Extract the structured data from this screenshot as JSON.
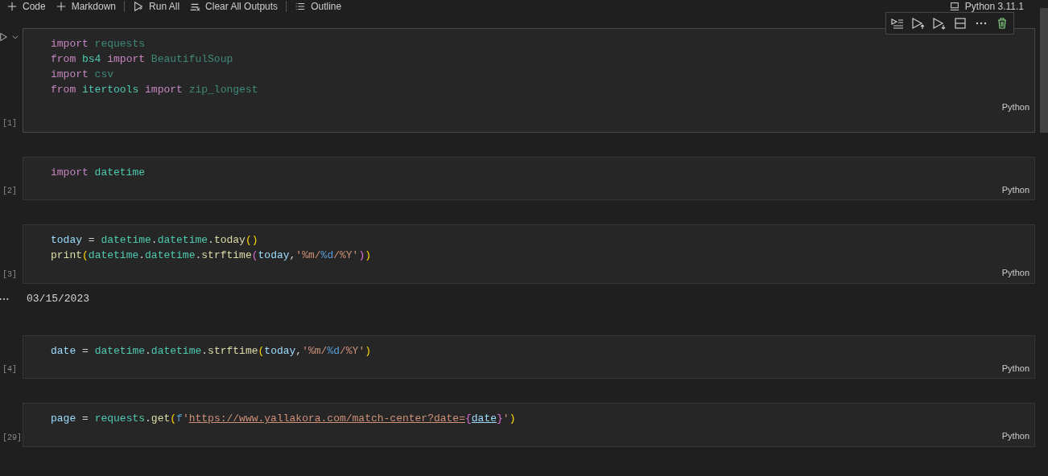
{
  "toolbar": {
    "items": [
      {
        "label": "Code",
        "kind": "add"
      },
      {
        "label": "Markdown",
        "kind": "add"
      },
      {
        "label": "Run All",
        "kind": "run"
      },
      {
        "label": "Clear All Outputs",
        "kind": "clear"
      },
      {
        "label": "Outline",
        "kind": "outline"
      }
    ],
    "kernel": "Python 3.11.1"
  },
  "cells": [
    {
      "execution_count": "[1]",
      "language": "Python",
      "focused": true,
      "lines": [
        [
          {
            "text": "import ",
            "kind": "keyword"
          },
          {
            "text": "requests",
            "kind": "unused"
          }
        ],
        [
          {
            "text": "from ",
            "kind": "keyword"
          },
          {
            "text": "bs4 ",
            "kind": "module"
          },
          {
            "text": "import ",
            "kind": "keyword"
          },
          {
            "text": "BeautifulSoup",
            "kind": "unused"
          }
        ],
        [
          {
            "text": "import ",
            "kind": "keyword"
          },
          {
            "text": "csv",
            "kind": "unused"
          }
        ],
        [
          {
            "text": "from ",
            "kind": "keyword"
          },
          {
            "text": "itertools ",
            "kind": "module"
          },
          {
            "text": "import ",
            "kind": "keyword"
          },
          {
            "text": "zip_longest",
            "kind": "unused"
          }
        ]
      ]
    },
    {
      "execution_count": "[2]",
      "language": "Python",
      "focused": false,
      "lines": [
        [
          {
            "text": "import ",
            "kind": "keyword"
          },
          {
            "text": "datetime",
            "kind": "module"
          }
        ]
      ]
    },
    {
      "execution_count": "[3]",
      "language": "Python",
      "focused": false,
      "lines": [
        [
          {
            "text": "today",
            "kind": "variable"
          },
          {
            "text": " = ",
            "kind": "plain"
          },
          {
            "text": "datetime",
            "kind": "module"
          },
          {
            "text": ".",
            "kind": "plain"
          },
          {
            "text": "datetime",
            "kind": "module"
          },
          {
            "text": ".",
            "kind": "plain"
          },
          {
            "text": "today",
            "kind": "function"
          },
          {
            "text": "()",
            "kind": "bracket1"
          }
        ],
        [
          {
            "text": "print",
            "kind": "function"
          },
          {
            "text": "(",
            "kind": "bracket1"
          },
          {
            "text": "datetime",
            "kind": "module"
          },
          {
            "text": ".",
            "kind": "plain"
          },
          {
            "text": "datetime",
            "kind": "module"
          },
          {
            "text": ".",
            "kind": "plain"
          },
          {
            "text": "strftime",
            "kind": "function"
          },
          {
            "text": "(",
            "kind": "bracket2"
          },
          {
            "text": "today",
            "kind": "variable"
          },
          {
            "text": ",",
            "kind": "plain"
          },
          {
            "text": "'%m/",
            "kind": "string"
          },
          {
            "text": "%d",
            "kind": "escape"
          },
          {
            "text": "/%Y'",
            "kind": "string"
          },
          {
            "text": ")",
            "kind": "bracket2"
          },
          {
            "text": ")",
            "kind": "bracket1"
          }
        ]
      ],
      "output": "03/15/2023"
    },
    {
      "execution_count": "[4]",
      "language": "Python",
      "focused": false,
      "lines": [
        [
          {
            "text": "date",
            "kind": "variable"
          },
          {
            "text": " = ",
            "kind": "plain"
          },
          {
            "text": "datetime",
            "kind": "module"
          },
          {
            "text": ".",
            "kind": "plain"
          },
          {
            "text": "datetime",
            "kind": "module"
          },
          {
            "text": ".",
            "kind": "plain"
          },
          {
            "text": "strftime",
            "kind": "function"
          },
          {
            "text": "(",
            "kind": "bracket1"
          },
          {
            "text": "today",
            "kind": "variable"
          },
          {
            "text": ",",
            "kind": "plain"
          },
          {
            "text": "'%m/",
            "kind": "string"
          },
          {
            "text": "%d",
            "kind": "escape"
          },
          {
            "text": "/%Y'",
            "kind": "string"
          },
          {
            "text": ")",
            "kind": "bracket1"
          }
        ]
      ]
    },
    {
      "execution_count": "[29]",
      "language": "Python",
      "focused": false,
      "lines": [
        [
          {
            "text": "page",
            "kind": "variable"
          },
          {
            "text": " = ",
            "kind": "plain"
          },
          {
            "text": "requests",
            "kind": "module"
          },
          {
            "text": ".",
            "kind": "plain"
          },
          {
            "text": "get",
            "kind": "function"
          },
          {
            "text": "(",
            "kind": "bracket1"
          },
          {
            "text": "f",
            "kind": "prefix"
          },
          {
            "text": "'",
            "kind": "string"
          },
          {
            "text": "https://www.yallakora.com/match-center?date=",
            "kind": "link"
          },
          {
            "text": "{",
            "kind": "bracket2"
          },
          {
            "text": "date",
            "kind": "linkvar"
          },
          {
            "text": "}",
            "kind": "bracket2"
          },
          {
            "text": "'",
            "kind": "string"
          },
          {
            "text": ")",
            "kind": "bracket1"
          }
        ]
      ]
    }
  ]
}
